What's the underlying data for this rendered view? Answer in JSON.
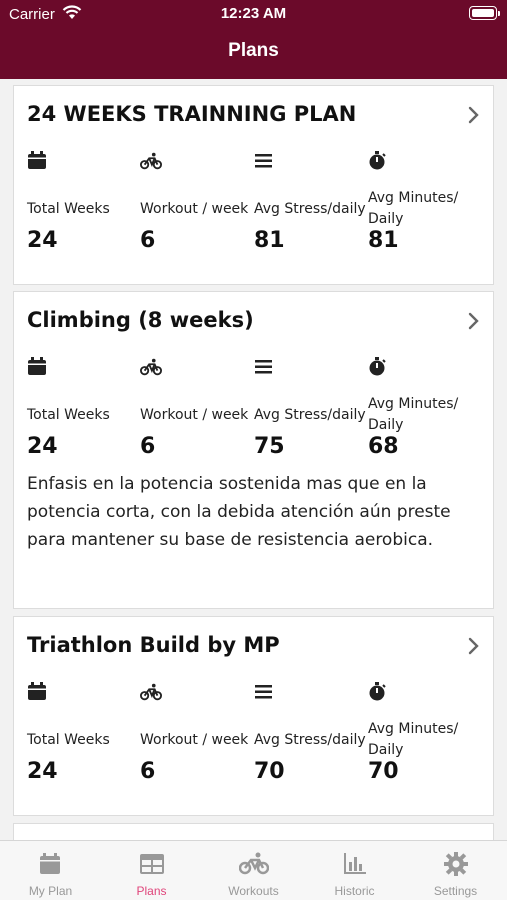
{
  "status_bar": {
    "carrier": "Carrier",
    "time": "12:23 AM"
  },
  "nav": {
    "title": "Plans"
  },
  "plans": [
    {
      "title": "24 WEEKS TRAINNING PLAN",
      "stats": [
        {
          "icon": "calendar-icon",
          "label": "Total Weeks",
          "value": "24"
        },
        {
          "icon": "bike-icon",
          "label": "Workout / week",
          "value": "6"
        },
        {
          "icon": "list-icon",
          "label": "Avg Stress/daily",
          "value": "81"
        },
        {
          "icon": "stopwatch-icon",
          "label": "Avg Minutes/ Daily",
          "value": "81"
        }
      ],
      "description": ""
    },
    {
      "title": "Climbing (8 weeks)",
      "stats": [
        {
          "icon": "calendar-icon",
          "label": "Total Weeks",
          "value": "24"
        },
        {
          "icon": "bike-icon",
          "label": "Workout / week",
          "value": "6"
        },
        {
          "icon": "list-icon",
          "label": "Avg Stress/daily",
          "value": "75"
        },
        {
          "icon": "stopwatch-icon",
          "label": "Avg Minutes/ Daily",
          "value": "68"
        }
      ],
      "description": "Enfasis en la potencia sostenida mas que en la potencia corta, con la debida atención aún preste para mantener su base de resistencia aerobica."
    },
    {
      "title": "Triathlon Build by MP",
      "stats": [
        {
          "icon": "calendar-icon",
          "label": "Total Weeks",
          "value": "24"
        },
        {
          "icon": "bike-icon",
          "label": "Workout / week",
          "value": "6"
        },
        {
          "icon": "list-icon",
          "label": "Avg Stress/daily",
          "value": "70"
        },
        {
          "icon": "stopwatch-icon",
          "label": "Avg Minutes/ Daily",
          "value": "70"
        }
      ],
      "description": ""
    }
  ],
  "tabs": [
    {
      "label": "My Plan",
      "icon": "calendar-icon",
      "active": false
    },
    {
      "label": "Plans",
      "icon": "grid-icon",
      "active": true
    },
    {
      "label": "Workouts",
      "icon": "bike-icon",
      "active": false
    },
    {
      "label": "Historic",
      "icon": "bar-chart-icon",
      "active": false
    },
    {
      "label": "Settings",
      "icon": "gear-icon",
      "active": false
    }
  ],
  "colors": {
    "header": "#6b0a2a",
    "active_tab": "#e0457b",
    "inactive_tab": "#999999"
  }
}
